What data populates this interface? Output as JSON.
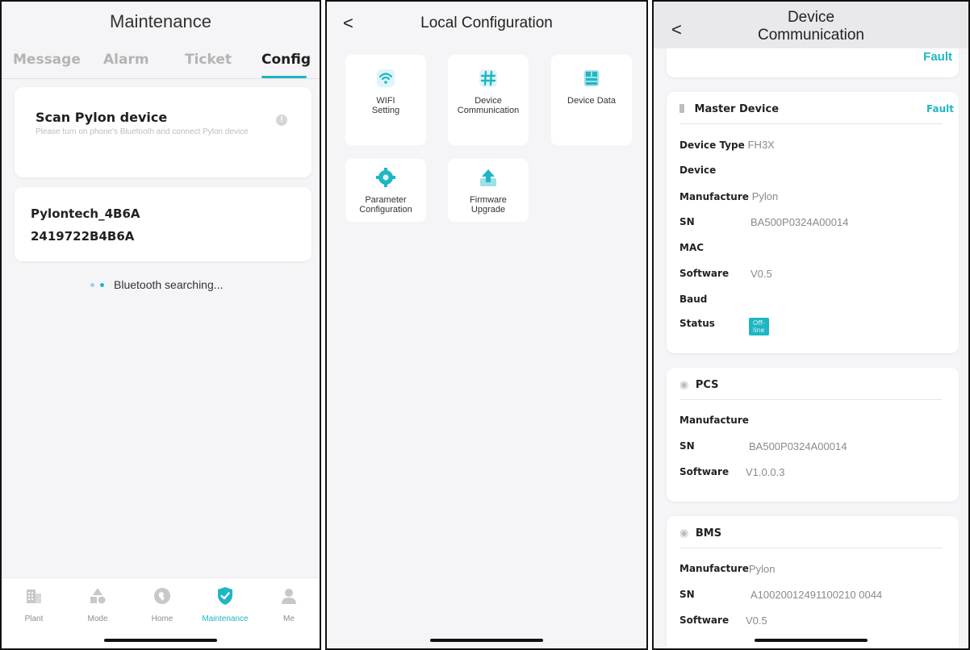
{
  "panel1": {
    "title": "Maintenance",
    "tabs": [
      {
        "label": "Message",
        "active": false
      },
      {
        "label": "Alarm",
        "active": false
      },
      {
        "label": "Ticket",
        "active": false
      },
      {
        "label": "Config",
        "active": true
      }
    ],
    "scan_card": {
      "title": "Scan Pylon device",
      "hint": "Please turn on phone's Bluetooth and connect Pylon device"
    },
    "device": {
      "name": "Pylontech_4B6A",
      "id": "2419722B4B6A"
    },
    "searching_text": "Bluetooth searching...",
    "nav": [
      {
        "label": "Plant",
        "icon": "building-icon",
        "active": false
      },
      {
        "label": "Mode",
        "icon": "shapes-icon",
        "active": false
      },
      {
        "label": "Home",
        "icon": "globe-icon",
        "active": false
      },
      {
        "label": "Maintenance",
        "icon": "shield-check-icon",
        "active": true
      },
      {
        "label": "Me",
        "icon": "person-icon",
        "active": false
      }
    ]
  },
  "panel2": {
    "back": "<",
    "title": "Local Configuration",
    "tiles": [
      {
        "label": "WIFI\nSetting",
        "icon": "wifi-icon"
      },
      {
        "label": "Device\nCommunication",
        "icon": "hash-icon"
      },
      {
        "label": "Device Data",
        "icon": "database-icon"
      },
      {
        "label": "Parameter\nConfiguration",
        "icon": "gear-icon"
      },
      {
        "label": "Firmware\nUpgrade",
        "icon": "upload-icon"
      }
    ]
  },
  "panel3": {
    "back": "<",
    "title": "Device\nCommunication",
    "top_fault": "Fault",
    "master": {
      "title": "Master Device",
      "status_label": "Fault",
      "device_type_key": "Device Type",
      "device_type_val": "FH3X",
      "device_key": "Device",
      "manufacture_key": "Manufacture",
      "manufacture_val": "Pylon",
      "sn_key": "SN",
      "sn_val": "BA500P0324A00014",
      "mac_key": "MAC",
      "software_key": "Software",
      "software_val": "V0.5",
      "baud_key": "Baud",
      "status_key": "Status",
      "status_val": "Off-line"
    },
    "pcs": {
      "title": "PCS",
      "manufacture_key": "Manufacture",
      "sn_key": "SN",
      "sn_val": "BA500P0324A00014",
      "software_key": "Software",
      "software_val": "V1.0.0.3"
    },
    "bms": {
      "title": "BMS",
      "manufacture_key": "Manufacture",
      "manufacture_val": "Pylon",
      "sn_key": "SN",
      "sn_val": "A10020012491100210 0044",
      "software_key": "Software",
      "software_val": "V0.5"
    }
  },
  "colors": {
    "accent": "#1fb6c4",
    "background": "#f5f4f6"
  }
}
